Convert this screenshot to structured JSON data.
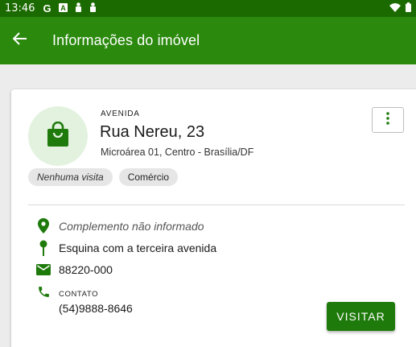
{
  "status_bar": {
    "time": "13:46",
    "left_icons": [
      "google-g-icon",
      "font-a-icon",
      "person-icon",
      "person-icon"
    ],
    "right_icons": [
      "wifi-icon",
      "battery-icon"
    ]
  },
  "app_bar": {
    "title": "Informações do imóvel",
    "back_icon": "arrow-back-icon",
    "color": "#2b8a0e"
  },
  "property": {
    "type": "AVENIDA",
    "address": "Rua Nereu, 23",
    "subtitle": "Microárea 01, Centro - Brasília/DF",
    "avatar_icon": "shopping-bag-icon"
  },
  "chips": [
    {
      "label": "Nenhuma visita"
    },
    {
      "label": "Comércio"
    }
  ],
  "details": {
    "complement": "Complemento não informado",
    "reference": "Esquina com a terceira avenida",
    "cep": "88220-000",
    "contact_label": "CONTATO",
    "contact_value": "(54)9888-8646"
  },
  "actions": {
    "visit_label": "VISITAR"
  },
  "colors": {
    "primary": "#2b8a0e",
    "primary_dark": "#1b6a00",
    "accent": "#1f7a0c"
  }
}
